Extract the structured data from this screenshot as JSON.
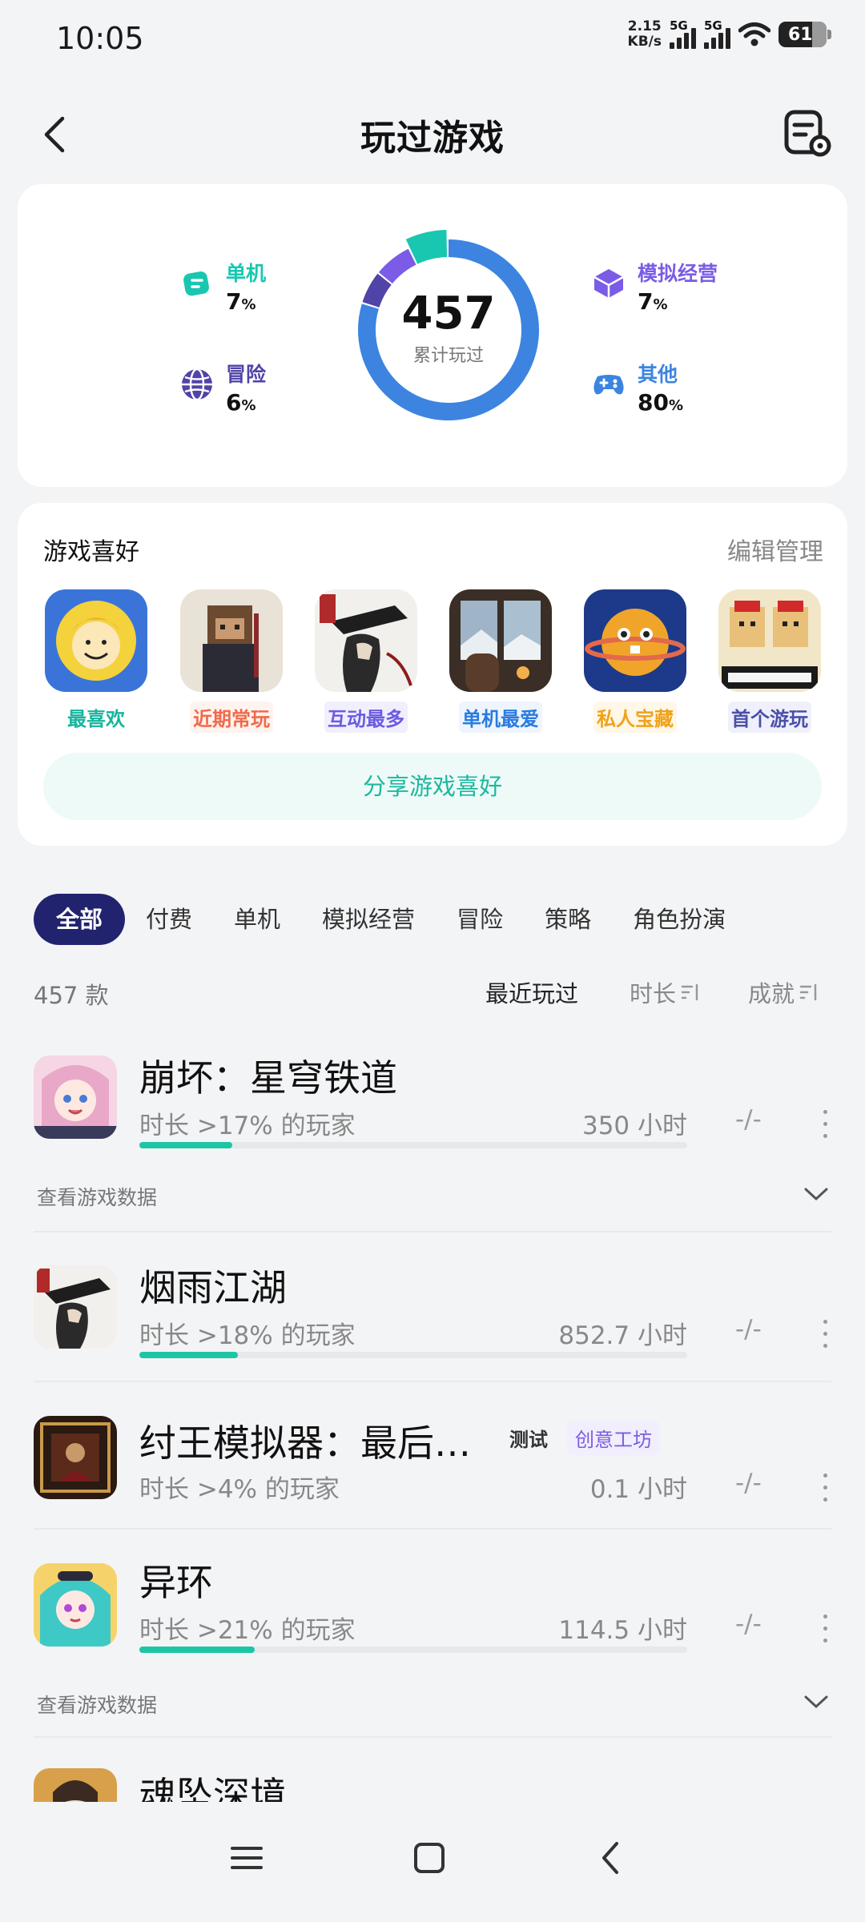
{
  "status": {
    "time": "10:05",
    "net_speed_top": "2.15",
    "net_speed_bottom": "KB/s",
    "sim1": "5G",
    "sim2": "5G",
    "battery": "61"
  },
  "header": {
    "title": "玩过游戏"
  },
  "summary": {
    "total": "457",
    "total_caption": "累计玩过",
    "categories": [
      {
        "name": "单机",
        "pct": "7",
        "color": "#19c7b0",
        "icon": "gamepad-single-icon"
      },
      {
        "name": "冒险",
        "pct": "6",
        "color": "#5044a8",
        "icon": "globe-icon"
      },
      {
        "name": "模拟经营",
        "pct": "7",
        "color": "#7a5ce6",
        "icon": "cube-icon"
      },
      {
        "name": "其他",
        "pct": "80",
        "color": "#3c84e0",
        "icon": "controller-icon"
      }
    ],
    "pct_unit": "%"
  },
  "preferences": {
    "title": "游戏喜好",
    "edit": "编辑管理",
    "items": [
      {
        "label": "最喜欢",
        "color": "#16b59d",
        "bg": "#ffffff"
      },
      {
        "label": "近期常玩",
        "color": "#f06a4b",
        "bg": "#fff3ef"
      },
      {
        "label": "互动最多",
        "color": "#6b5be2",
        "bg": "#f1effd"
      },
      {
        "label": "单机最爱",
        "color": "#2a7be0",
        "bg": "#eef5fe"
      },
      {
        "label": "私人宝藏",
        "color": "#f0a21a",
        "bg": "#fff7e8"
      },
      {
        "label": "首个游玩",
        "color": "#4a4fa8",
        "bg": "#eff0fb"
      }
    ],
    "share": "分享游戏喜好"
  },
  "filters": [
    "全部",
    "付费",
    "单机",
    "模拟经营",
    "冒险",
    "策略",
    "角色扮演"
  ],
  "list": {
    "count": "457 款",
    "sort_recent": "最近玩过",
    "sort_duration": "时长",
    "sort_achievement": "成就",
    "view_data": "查看游戏数据"
  },
  "games": [
    {
      "name": "崩坏：星穹铁道",
      "sub": "时长 >17% 的玩家",
      "hours": "350 小时",
      "ach": "-/-",
      "progress": 0.17
    },
    {
      "name": "烟雨江湖",
      "sub": "时长 >18% 的玩家",
      "hours": "852.7 小时",
      "ach": "-/-",
      "progress": 0.18
    },
    {
      "name": "纣王模拟器：最后…",
      "sub": "时长 >4% 的玩家",
      "hours": "0.1 小时",
      "ach": "-/-",
      "tag_test": "测试",
      "tag_workshop": "创意工坊"
    },
    {
      "name": "异环",
      "sub": "时长 >21% 的玩家",
      "hours": "114.5 小时",
      "ach": "-/-",
      "progress": 0.21
    },
    {
      "name": "魂坠深境"
    }
  ]
}
